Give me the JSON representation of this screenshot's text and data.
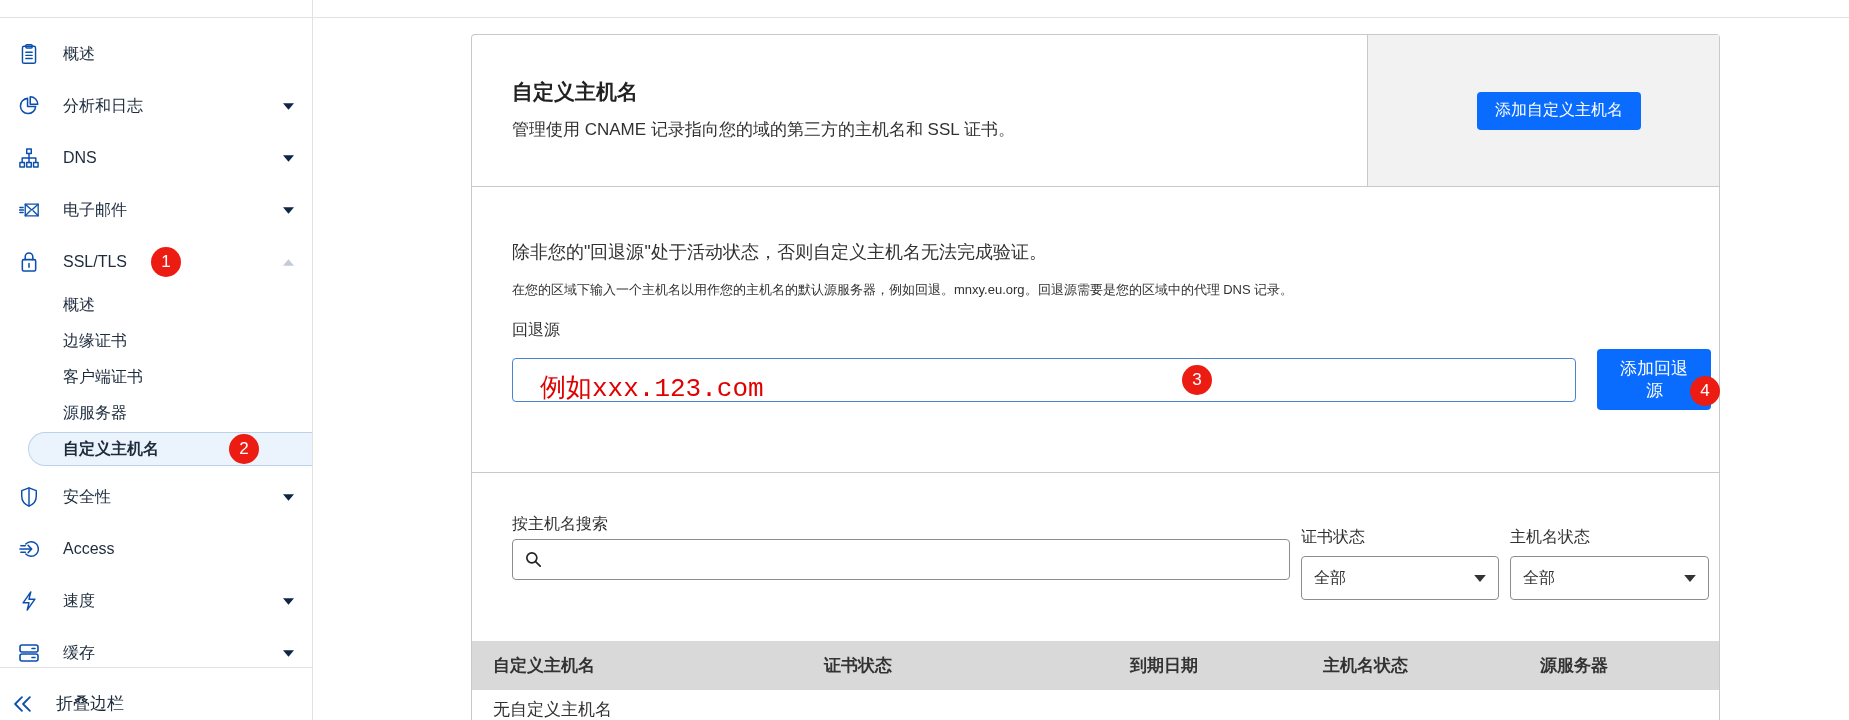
{
  "sidebar": {
    "items": [
      {
        "label": "概述",
        "kind": "link"
      },
      {
        "label": "分析和日志",
        "kind": "group",
        "expanded": false
      },
      {
        "label": "DNS",
        "kind": "group",
        "expanded": false
      },
      {
        "label": "电子邮件",
        "kind": "group",
        "expanded": false
      },
      {
        "label": "SSL/TLS",
        "kind": "group",
        "expanded": true,
        "marker": "1",
        "children": [
          {
            "label": "概述",
            "selected": false
          },
          {
            "label": "边缘证书",
            "selected": false
          },
          {
            "label": "客户端证书",
            "selected": false
          },
          {
            "label": "源服务器",
            "selected": false
          },
          {
            "label": "自定义主机名",
            "selected": true,
            "marker": "2"
          }
        ]
      },
      {
        "label": "安全性",
        "kind": "group",
        "expanded": false
      },
      {
        "label": "Access",
        "kind": "link"
      },
      {
        "label": "速度",
        "kind": "group",
        "expanded": false
      },
      {
        "label": "缓存",
        "kind": "group",
        "expanded": false
      }
    ],
    "collapse_label": "折叠边栏"
  },
  "header_card": {
    "title": "自定义主机名",
    "description": "管理使用 CNAME 记录指向您的域的第三方的主机名和 SSL 证书。",
    "button": "添加自定义主机名"
  },
  "fallback": {
    "notice": "除非您的\"回退源\"处于活动状态，否则自定义主机名无法完成验证。",
    "help": "在您的区域下输入一个主机名以用作您的主机名的默认源服务器，例如回退。mnxy.eu.org。回退源需要是您的区域中的代理 DNS 记录。",
    "label": "回退源",
    "note": "例如xxx.123.com",
    "field_marker": "3",
    "button": "添加回退源",
    "button_marker": "4"
  },
  "filters": {
    "search_label": "按主机名搜索",
    "selects": [
      {
        "label": "证书状态",
        "value": "全部"
      },
      {
        "label": "主机名状态",
        "value": "全部"
      }
    ]
  },
  "table": {
    "columns": [
      "自定义主机名",
      "证书状态",
      "到期日期",
      "主机名状态",
      "源服务器"
    ],
    "empty_text": "无自定义主机名"
  }
}
